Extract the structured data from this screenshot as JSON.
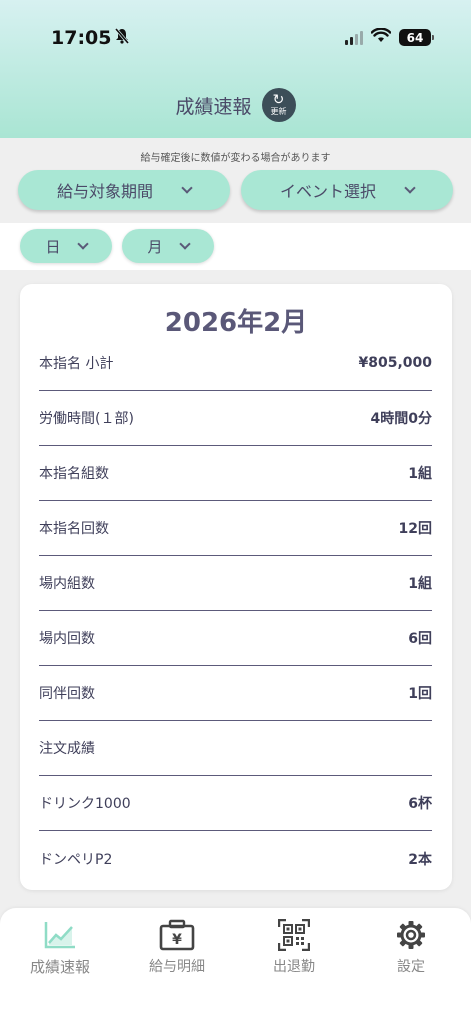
{
  "status": {
    "time": "17:05",
    "battery": "64"
  },
  "header": {
    "title": "成績速報",
    "refresh_label": "更新"
  },
  "notice": "給与確定後に数値が変わる場合があります",
  "filters": {
    "period": "給与対象期間",
    "event": "イベント選択",
    "day": "日",
    "month": "月"
  },
  "report": {
    "title": "2026年2月",
    "rows": [
      {
        "label": "本指名 小計",
        "value": "¥805,000"
      },
      {
        "label": "労働時間(１部)",
        "value": "4時間0分"
      },
      {
        "label": "本指名組数",
        "value": "1組"
      },
      {
        "label": "本指名回数",
        "value": "12回"
      },
      {
        "label": "場内組数",
        "value": "1組"
      },
      {
        "label": "場内回数",
        "value": "6回"
      },
      {
        "label": "同伴回数",
        "value": "1回"
      },
      {
        "label": "注文成績",
        "value": ""
      },
      {
        "label": "ドリンク1000",
        "value": "6杯"
      },
      {
        "label": "ドンペリP2",
        "value": "2本"
      }
    ]
  },
  "tabs": [
    {
      "label": "成績速報",
      "icon": "chart-icon",
      "active": true
    },
    {
      "label": "給与明細",
      "icon": "wallet-icon",
      "active": false
    },
    {
      "label": "出退勤",
      "icon": "qr-icon",
      "active": false
    },
    {
      "label": "設定",
      "icon": "gear-icon",
      "active": false
    }
  ],
  "colors": {
    "header_gradient_top": "#d7f1f1",
    "header_gradient_bottom": "#a9e5d3",
    "pill": "#a9e7d4",
    "accent_chart": "#8fdcc6",
    "text": "#4b4a68"
  }
}
